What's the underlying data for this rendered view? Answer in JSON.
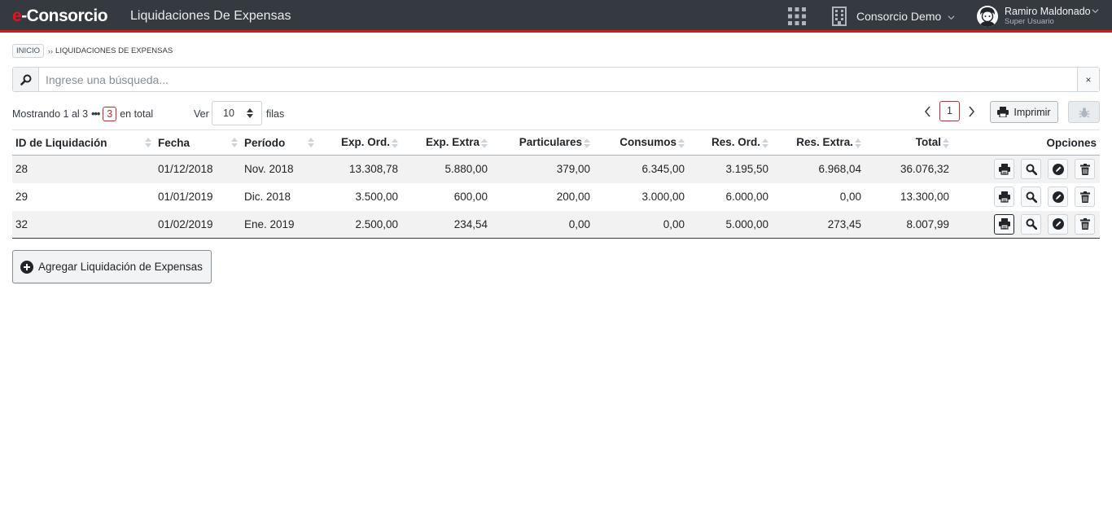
{
  "app": {
    "brand_prefix": "e",
    "brand_suffix": "-Consorcio",
    "page_heading": "Liquidaciones De Expensas",
    "consorcio": "Consorcio Demo",
    "user_name": "Ramiro Maldonado",
    "user_role": "Super Usuario"
  },
  "breadcrumb": {
    "home": "INICIO",
    "separator": "››",
    "current": "LIQUIDACIONES DE EXPENSAS"
  },
  "search": {
    "placeholder": "Ingrese una búsqueda...",
    "value": "",
    "clear": "×"
  },
  "info": {
    "showing": "Mostrando 1 al 3",
    "dots": "•••",
    "total": "3",
    "total_suffix": "en total",
    "ver": "Ver",
    "rows_per_page": "10",
    "filas": "filas",
    "current_page": "1",
    "print": "Imprimir"
  },
  "table": {
    "columns": [
      "ID de Liquidación",
      "Fecha",
      "Período",
      "Exp. Ord.",
      "Exp. Extra",
      "Particulares",
      "Consumos",
      "Res. Ord.",
      "Res. Extra.",
      "Total",
      "Opciones"
    ],
    "rows": [
      [
        "28",
        "01/12/2018",
        "Nov. 2018",
        "13.308,78",
        "5.880,00",
        "379,00",
        "6.345,00",
        "3.195,50",
        "6.968,04",
        "36.076,32"
      ],
      [
        "29",
        "01/01/2019",
        "Dic. 2018",
        "3.500,00",
        "600,00",
        "200,00",
        "3.000,00",
        "6.000,00",
        "0,00",
        "13.300,00"
      ],
      [
        "32",
        "01/02/2019",
        "Ene. 2019",
        "2.500,00",
        "234,54",
        "0,00",
        "0,00",
        "5.000,00",
        "273,45",
        "8.007,99"
      ]
    ],
    "row_action_icons": [
      "printer-icon",
      "magnifier-icon",
      "pencil-icon",
      "trash-icon"
    ]
  },
  "actions": {
    "add": "Agregar Liquidación de Expensas"
  },
  "colors": {
    "topbar": "#343a40",
    "accent": "#d9161c",
    "stripe": "#f2f2f2"
  }
}
